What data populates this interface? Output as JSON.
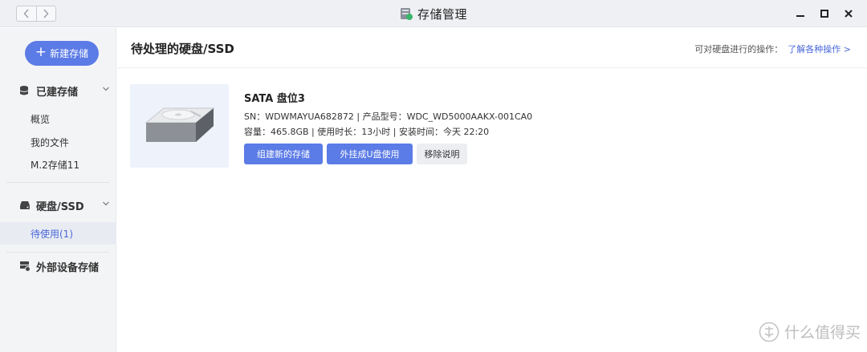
{
  "window": {
    "title": "存储管理",
    "app_icon": "storage-app-icon",
    "controls": [
      "minimize-icon",
      "maximize-icon",
      "close-icon"
    ]
  },
  "sidebar": {
    "new_button": "新建存储",
    "groups": [
      {
        "label": "已建存储",
        "icon": "database-icon",
        "items": [
          "概览",
          "我的文件",
          "M.2存储11"
        ]
      },
      {
        "label": "硬盘/SSD",
        "icon": "hdd-icon",
        "items": [
          "待使用(1)"
        ]
      },
      {
        "label": "外部设备存储",
        "icon": "external-storage-icon",
        "items": []
      }
    ],
    "active_item": "待使用(1)"
  },
  "main": {
    "title": "待处理的硬盘/SSD",
    "hint": "可对硬盘进行的操作：",
    "hint_link": "了解各种操作 >",
    "disk": {
      "name": "SATA 盘位3",
      "line1": "SN：WDWMAYUA682872 | 产品型号：WDC_WD5000AAKX-001CA0",
      "line2": "容量：465.8GB | 使用时长：13小时 | 安装时间：今天 22:20",
      "actions": [
        "组建新的存储",
        "外挂成U盘使用",
        "移除说明"
      ]
    }
  },
  "watermark": "什么值得买",
  "colors": {
    "accent": "#5b7be6",
    "link": "#4a68d8",
    "sidebar_bg": "#f3f4f6",
    "thumb_bg": "#edf2fb"
  }
}
